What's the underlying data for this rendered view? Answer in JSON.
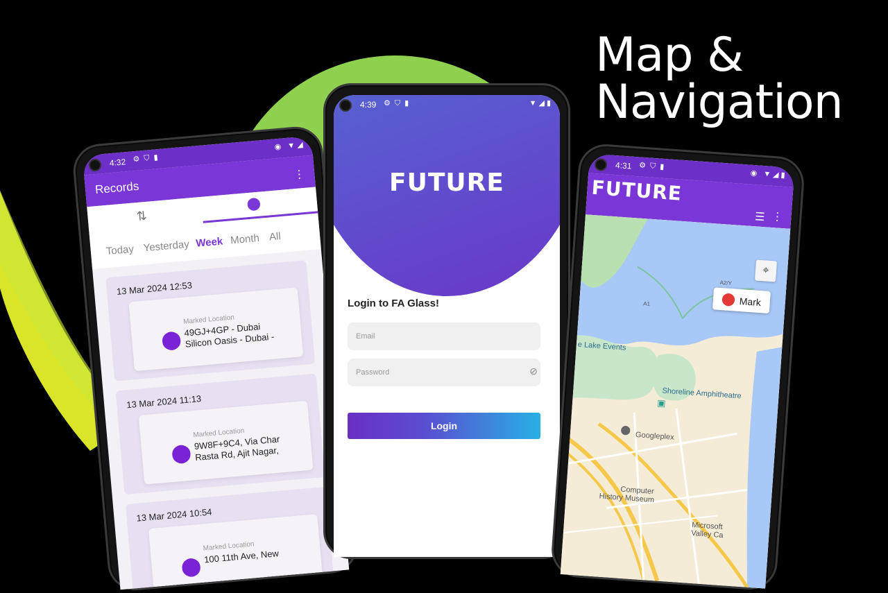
{
  "headline": {
    "line1": "Map &",
    "line2": "Navigation"
  },
  "colors": {
    "purple": "#7a36d6",
    "purple_dark": "#6c2fc7",
    "accent_green": "#8fd14f",
    "accent_yellow": "#e6f02a",
    "water": "#a8c8f8",
    "park": "#c8e6c9",
    "road": "#f6c84a"
  },
  "records_phone": {
    "status": {
      "time": "4:32"
    },
    "app_title": "Records",
    "menu_icon": "more-vert-icon",
    "icon_tabs": [
      "route-icon",
      "location-pin-icon"
    ],
    "filter_tabs": [
      "Today",
      "Yesterday",
      "Week",
      "Month",
      "All"
    ],
    "active_filter": "Week",
    "records": [
      {
        "date": "13 Mar 2024 12:53",
        "label": "Marked Location",
        "address": "49GJ+4GP - Dubai Silicon Oasis - Dubai -"
      },
      {
        "date": "13 Mar 2024 11:13",
        "label": "Marked Location",
        "address": "9W8F+9C4, Via Char Rasta Rd, Ajit Nagar,"
      },
      {
        "date": "13 Mar 2024 10:54",
        "label": "Marked Location",
        "address": "100 11th Ave, New"
      }
    ]
  },
  "login_phone": {
    "status": {
      "time": "4:39"
    },
    "logo": "FUTURE",
    "title": "Login to FA Glass!",
    "email_placeholder": "Email",
    "password_placeholder": "Password",
    "login_label": "Login"
  },
  "map_phone": {
    "status": {
      "time": "4:31"
    },
    "logo": "FUTURE",
    "mark_label": "Mark",
    "places": {
      "lake": "e Lake Events",
      "amphitheatre": "Shoreline Amphitheatre",
      "googleplex": "Googleplex",
      "museum_1": "Computer",
      "museum_2": "History Museum",
      "microsoft_1": "Microsoft",
      "microsoft_2": "Valley Ca",
      "road_a1": "A1",
      "road_a2": "A2/Y"
    }
  }
}
